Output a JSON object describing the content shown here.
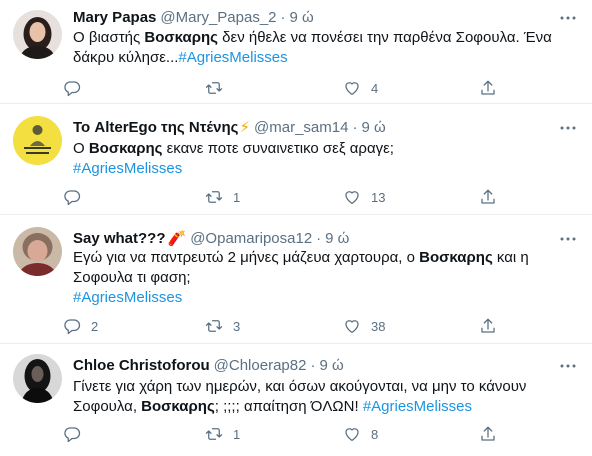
{
  "tweets": [
    {
      "name": "Mary Papas",
      "handle": "@Mary_Papas_2",
      "dot": "·",
      "time": "9 ώ",
      "text_1": "Ο βιαστής ",
      "bold_1": "Βοσκαρης",
      "text_2": " δεν ήθελε να πονέσει την παρθένα Σοφουλα. Ένα δάκρυ κύλησε...",
      "hashtag": "#AgriesMelisses",
      "reply_count": "",
      "retweet_count": "",
      "like_count": "4"
    },
    {
      "name": "Το AlterEgo της Ντένης",
      "emoji": "⚡",
      "handle": "@mar_sam14",
      "dot": "·",
      "time": "9 ώ",
      "text_1": "Ο ",
      "bold_1": "Βοσκαρης",
      "text_2": " εκανε ποτε συναινετικο σεξ αραγε;",
      "hashtag": "#AgriesMelisses",
      "reply_count": "",
      "retweet_count": "1",
      "like_count": "13"
    },
    {
      "name": "Say what??? ",
      "emoji": "🧨",
      "handle": "@Opamariposa12",
      "dot": "·",
      "time": "9 ώ",
      "text_1": "Εγώ για να παντρευτώ 2 μήνες μάζευα χαρτουρα, ο ",
      "bold_1": "Βοσκαρης",
      "text_2": " και η Σοφουλα τι φαση;",
      "hashtag": "#AgriesMelisses",
      "reply_count": "2",
      "retweet_count": "3",
      "like_count": "38"
    },
    {
      "name": "Chloe Christoforou",
      "handle": "@Chloerap82",
      "dot": "·",
      "time": "9 ώ",
      "text_1": "Γίνετε για χάρη των ημερών, και όσων ακούγονται, να μην το κάνουν Σοφουλα, ",
      "bold_1": "Βοσκαρης",
      "text_2": "; ;;;; απαίτηση ΌΛΩΝ! ",
      "hashtag": "#AgriesMelisses",
      "reply_count": "",
      "retweet_count": "1",
      "like_count": "8"
    }
  ],
  "colors": {
    "text": "#0f1419",
    "secondary": "#5b7083",
    "hashtag": "#1b95e0",
    "divider": "#ebeef0"
  },
  "icons": {
    "reply": "reply-icon",
    "retweet": "retweet-icon",
    "like": "heart-icon",
    "share": "share-icon",
    "more": "more-icon"
  }
}
